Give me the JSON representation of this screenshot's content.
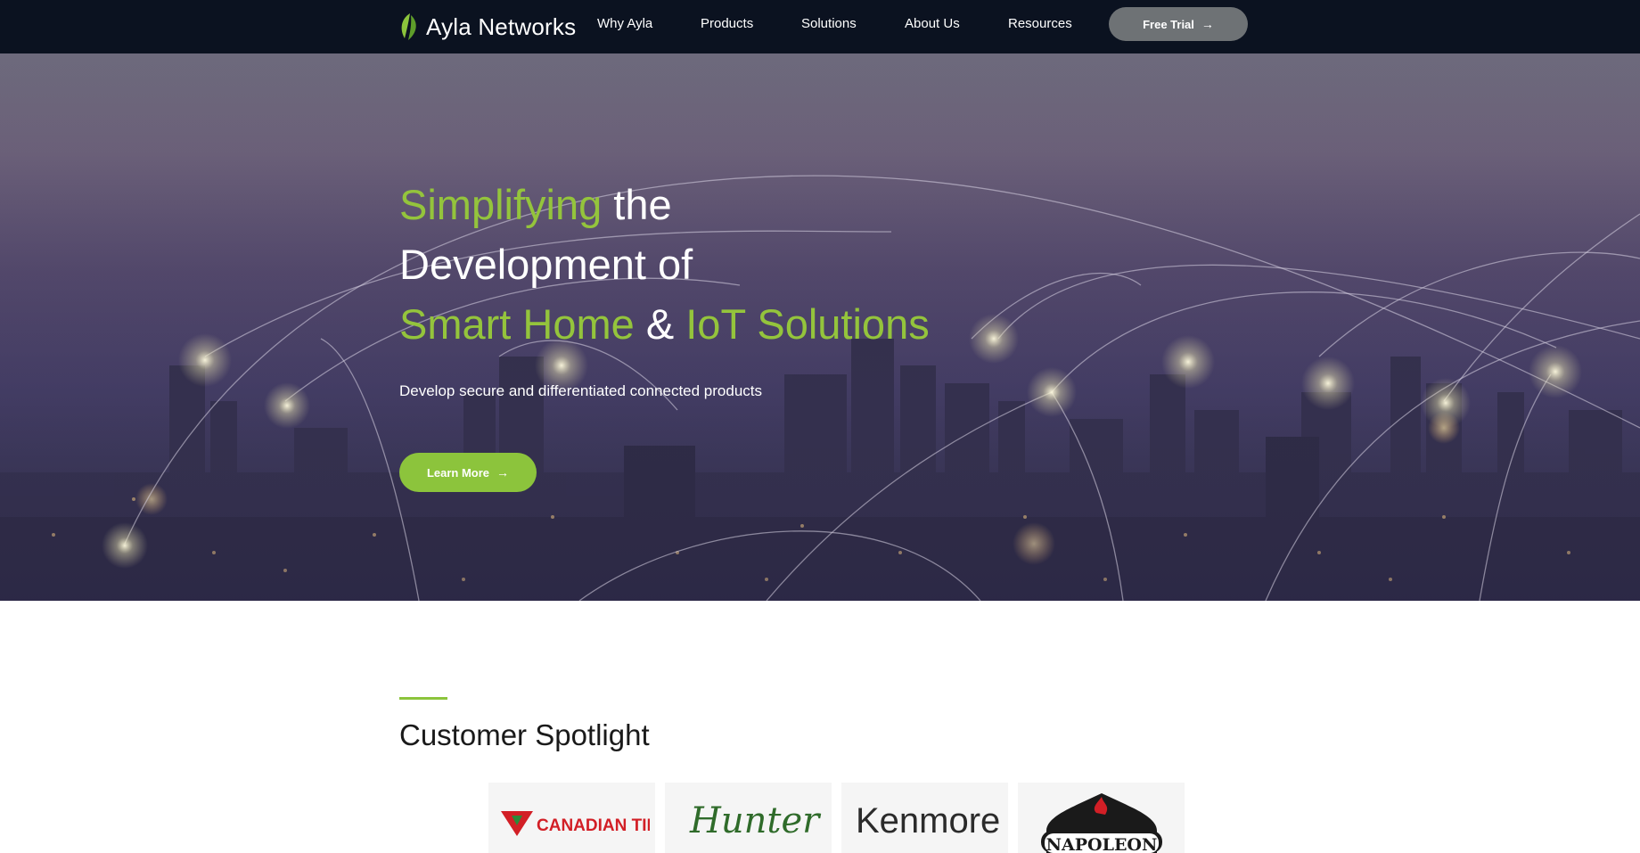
{
  "nav": {
    "brand": "Ayla Networks",
    "items": [
      {
        "label": "Why Ayla"
      },
      {
        "label": "Products"
      },
      {
        "label": "Solutions"
      },
      {
        "label": "About Us"
      },
      {
        "label": "Resources"
      }
    ],
    "cta_label": "Free Trial"
  },
  "hero": {
    "title_line1_green": "Simplifying",
    "title_line1_white": " the",
    "title_line2": "Development of",
    "title_line3_green_a": "Smart Home",
    "title_line3_white": " & ",
    "title_line3_green_b": "IoT Solutions",
    "subtitle": "Develop secure and differentiated connected products",
    "cta_label": "Learn More"
  },
  "spotlight": {
    "heading": "Customer Spotlight",
    "customers": [
      {
        "name": "CANADIAN TIRE"
      },
      {
        "name": "Hunter"
      },
      {
        "name": "Kenmore"
      },
      {
        "name": "NAPOLEON"
      }
    ]
  },
  "colors": {
    "nav_bg": "#0b1220",
    "accent_green": "#8cc43c",
    "trial_button": "#6e7275"
  }
}
